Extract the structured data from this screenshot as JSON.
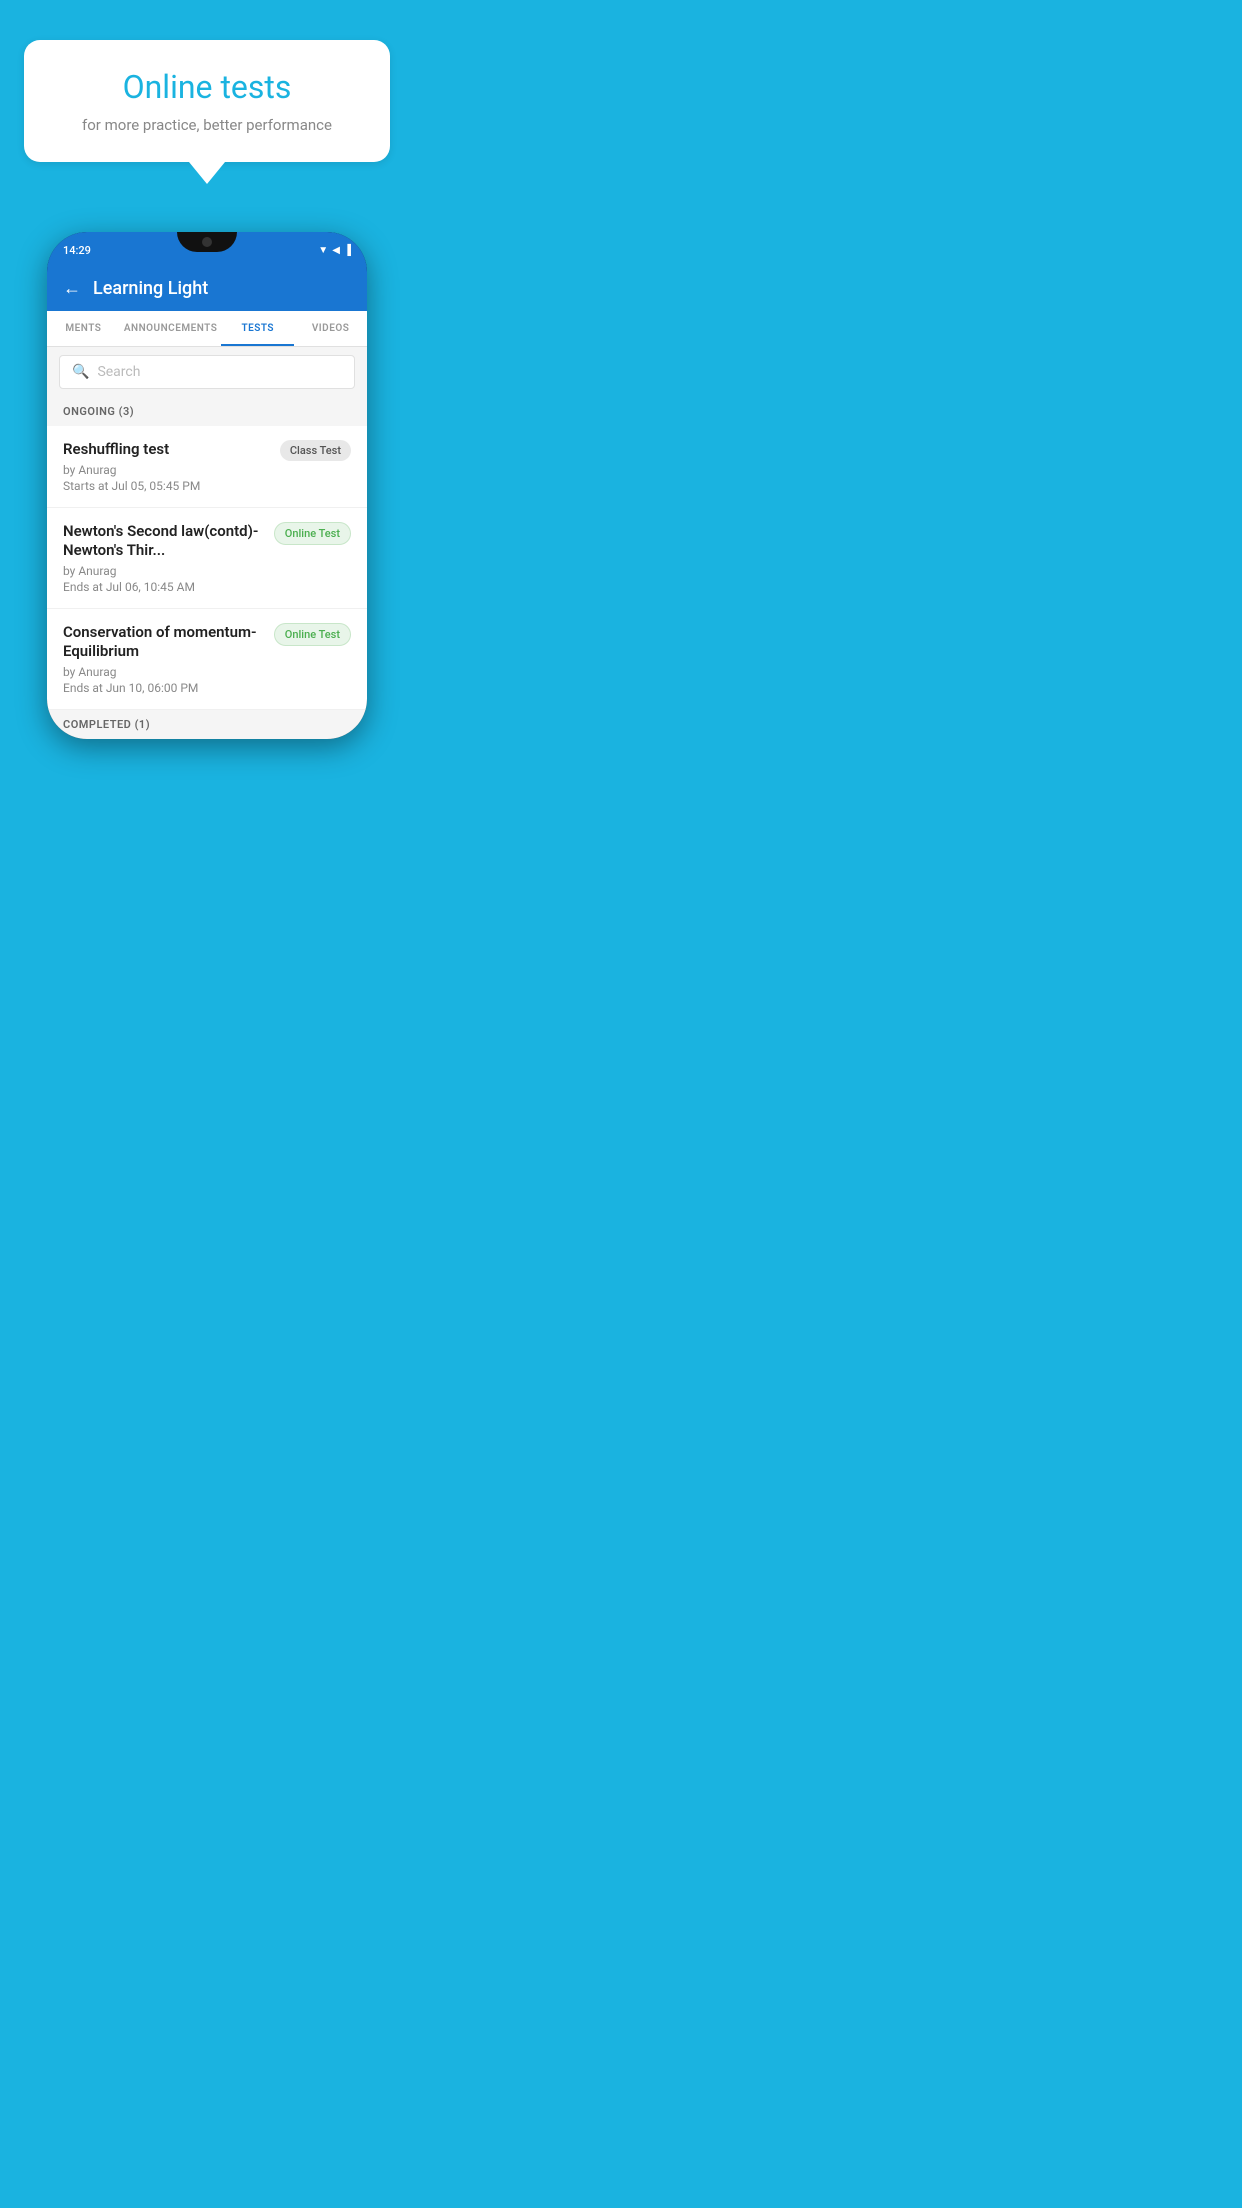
{
  "background_color": "#1ab3e0",
  "speech_bubble": {
    "title": "Online tests",
    "subtitle": "for more practice, better performance"
  },
  "phone": {
    "status_bar": {
      "time": "14:29",
      "icons": [
        "▼",
        "◀",
        "▐"
      ]
    },
    "app_bar": {
      "title": "Learning Light",
      "back_label": "←"
    },
    "tabs": [
      {
        "label": "MENTS",
        "active": false
      },
      {
        "label": "ANNOUNCEMENTS",
        "active": false
      },
      {
        "label": "TESTS",
        "active": true
      },
      {
        "label": "VIDEOS",
        "active": false
      }
    ],
    "search": {
      "placeholder": "Search"
    },
    "ongoing_section": {
      "label": "ONGOING (3)"
    },
    "tests": [
      {
        "name": "Reshuffling test",
        "by": "by Anurag",
        "date": "Starts at  Jul 05, 05:45 PM",
        "badge": "Class Test",
        "badge_type": "class"
      },
      {
        "name": "Newton's Second law(contd)-Newton's Thir...",
        "by": "by Anurag",
        "date": "Ends at  Jul 06, 10:45 AM",
        "badge": "Online Test",
        "badge_type": "online"
      },
      {
        "name": "Conservation of momentum-Equilibrium",
        "by": "by Anurag",
        "date": "Ends at  Jun 10, 06:00 PM",
        "badge": "Online Test",
        "badge_type": "online"
      }
    ],
    "completed_section": {
      "label": "COMPLETED (1)"
    }
  }
}
